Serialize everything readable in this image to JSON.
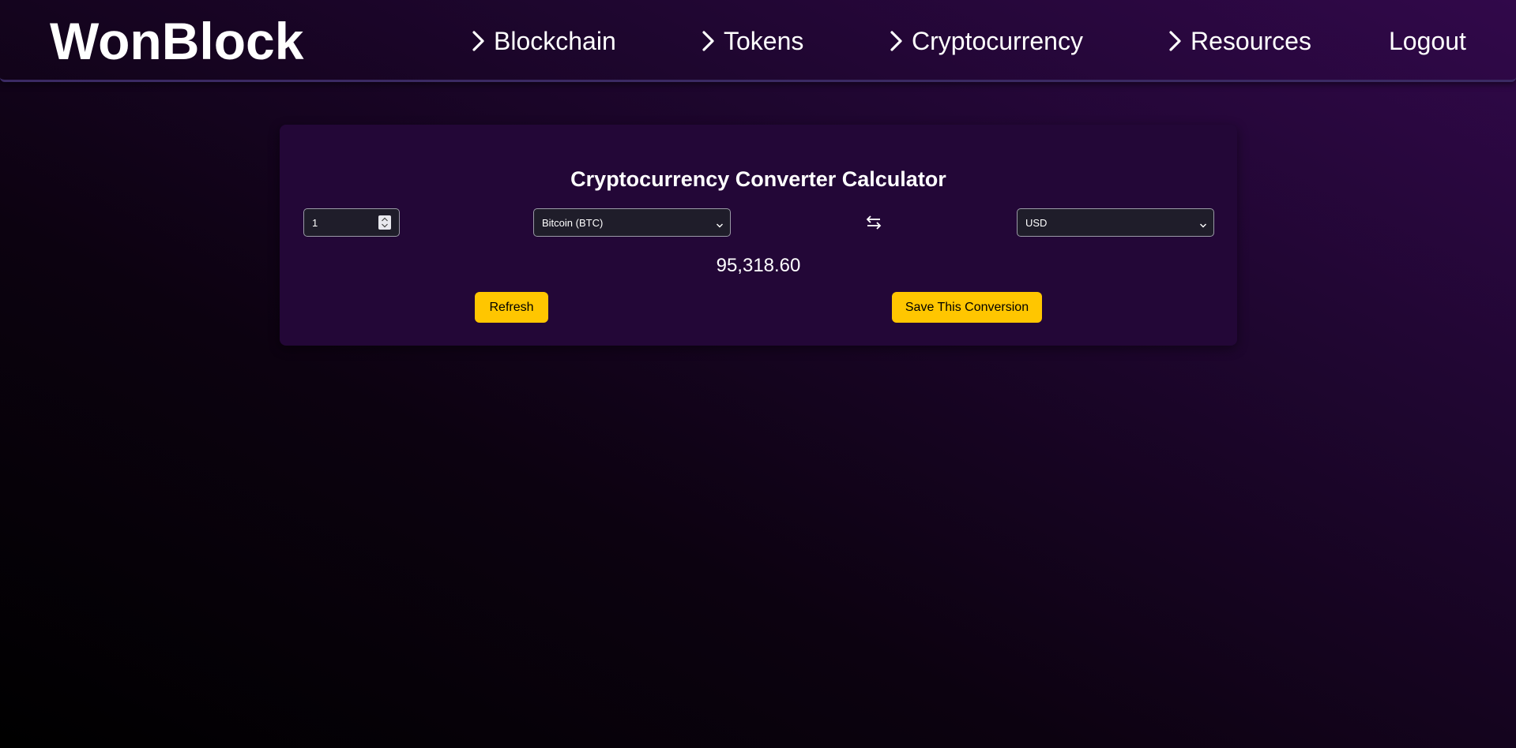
{
  "header": {
    "brand": "WonBlock",
    "nav": [
      {
        "label": "Blockchain",
        "chevron": true
      },
      {
        "label": "Tokens",
        "chevron": true
      },
      {
        "label": "Cryptocurrency",
        "chevron": true
      },
      {
        "label": "Resources",
        "chevron": true
      },
      {
        "label": "Logout",
        "chevron": false
      }
    ]
  },
  "converter": {
    "title": "Cryptocurrency Converter Calculator",
    "amount_value": "1",
    "crypto_selected": "Bitcoin (BTC)",
    "currency_selected": "USD",
    "swap_icon": "⇆",
    "result": "95,318.60",
    "refresh_label": "Refresh",
    "save_label": "Save This Conversion"
  },
  "colors": {
    "accent_button": "#ffc600",
    "card_background": "#230737",
    "header_border": "#3b2a63"
  }
}
